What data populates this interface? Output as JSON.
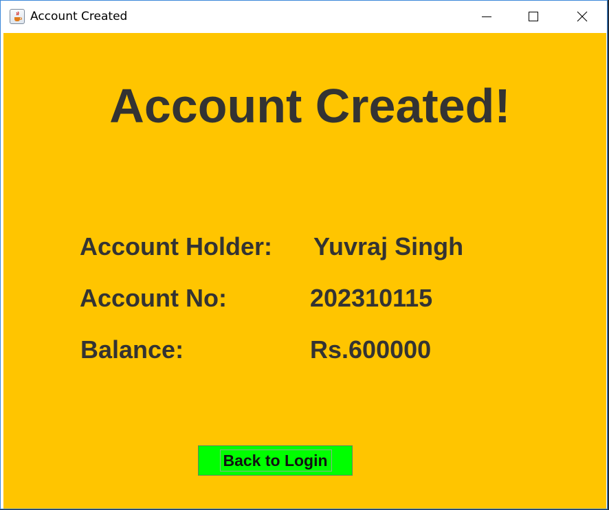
{
  "window": {
    "title": "Account Created",
    "app_icon": "java-cup-icon",
    "controls": [
      "minimize-icon",
      "maximize-icon",
      "close-icon"
    ]
  },
  "main": {
    "heading": "Account Created!",
    "details": [
      {
        "label": "Account Holder:",
        "value": "Yuvraj Singh"
      },
      {
        "label": "Account No:",
        "value": "202310115"
      },
      {
        "label": "Balance:",
        "value": "Rs.600000"
      }
    ],
    "back_button_label": "Back to Login"
  },
  "colors": {
    "background": "#ffc500",
    "text": "#333333",
    "button": "#00ff00"
  }
}
